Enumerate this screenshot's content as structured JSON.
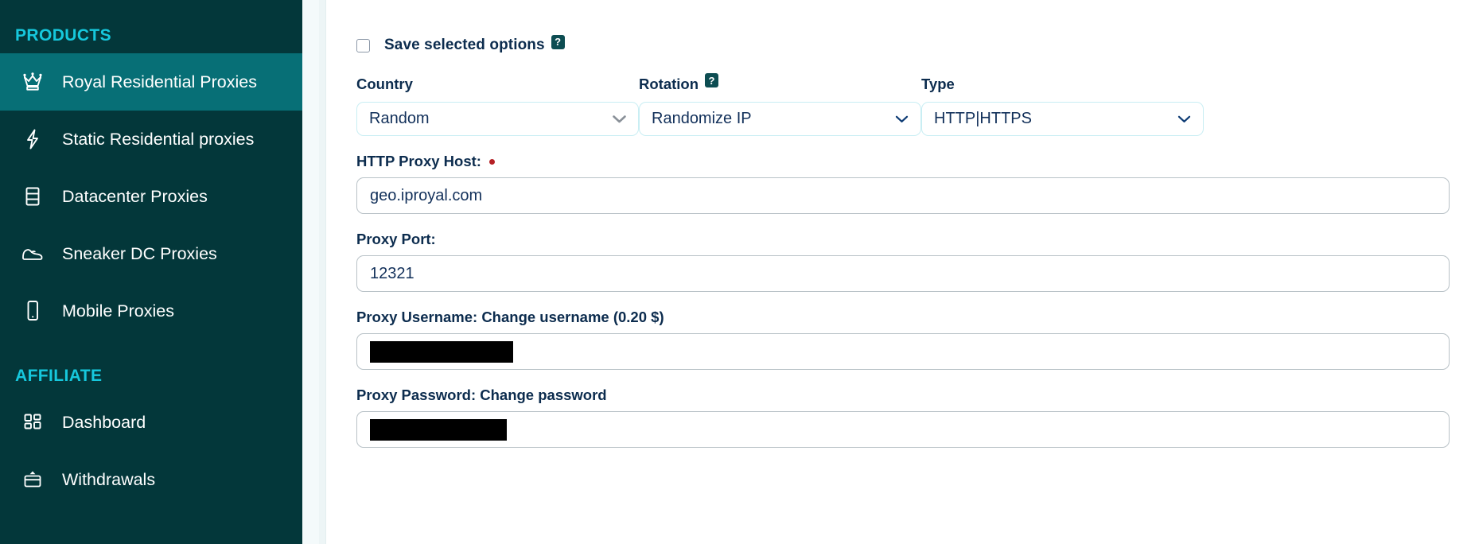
{
  "sidebar": {
    "sections": [
      {
        "title": "PRODUCTS"
      },
      {
        "title": "AFFILIATE"
      }
    ],
    "products": [
      {
        "label": "Royal Residential Proxies",
        "icon": "crown-icon",
        "active": true
      },
      {
        "label": "Static Residential proxies",
        "icon": "lightning-icon",
        "active": false
      },
      {
        "label": "Datacenter Proxies",
        "icon": "server-icon",
        "active": false
      },
      {
        "label": "Sneaker DC Proxies",
        "icon": "sneaker-icon",
        "active": false
      },
      {
        "label": "Mobile Proxies",
        "icon": "mobile-icon",
        "active": false
      }
    ],
    "affiliate": [
      {
        "label": "Dashboard",
        "icon": "grid-icon",
        "active": false
      },
      {
        "label": "Withdrawals",
        "icon": "card-upload-icon",
        "active": false
      }
    ]
  },
  "form": {
    "save_options": {
      "label": "Save selected options",
      "checked": false,
      "help_glyph": "?"
    },
    "selects": [
      {
        "label": "Country",
        "value": "Random",
        "help": false,
        "chevron_color": "#8a9199"
      },
      {
        "label": "Rotation",
        "value": "Randomize IP",
        "help": true,
        "help_glyph": "?",
        "chevron_color": "#0d3b74"
      },
      {
        "label": "Type",
        "value": "HTTP|HTTPS",
        "help": false,
        "chevron_color": "#0d3b74"
      }
    ],
    "fields": [
      {
        "label": "HTTP Proxy Host:",
        "required": true,
        "value": "geo.iproyal.com",
        "redacted": false
      },
      {
        "label": "Proxy Port:",
        "required": false,
        "value": "12321",
        "redacted": false
      },
      {
        "label": "Proxy Username: Change username (0.20 $)",
        "required": false,
        "value": "",
        "redacted": true
      },
      {
        "label": "Proxy Password: Change password",
        "required": false,
        "value": "",
        "redacted": true
      }
    ]
  },
  "colors": {
    "sidebar_bg": "#03373a",
    "sidebar_active": "#076f76",
    "section_accent": "#16c8dd",
    "label_navy": "#0c2c4e",
    "value_navy": "#12305a",
    "select_border": "#c9eef3",
    "input_border": "#b9c2c7",
    "required_dot": "#b52025",
    "help_badge": "#0d4d52",
    "gutter": "#f4fafb"
  }
}
